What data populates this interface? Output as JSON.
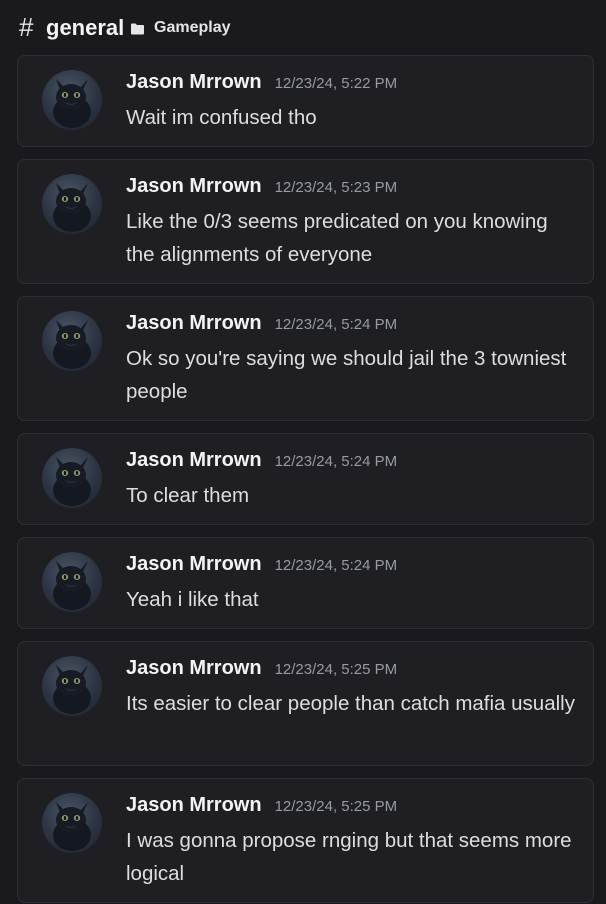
{
  "header": {
    "hash": "#",
    "channel": "general",
    "category_icon": "folder-icon",
    "category": "Gameplay"
  },
  "messages": [
    {
      "author": "Jason Mrrown",
      "time": "12/23/24, 5:22 PM",
      "text": "Wait im confused tho"
    },
    {
      "author": "Jason Mrrown",
      "time": "12/23/24, 5:23 PM",
      "text": "Like the 0/3 seems predicated on you knowing the alignments of everyone"
    },
    {
      "author": "Jason Mrrown",
      "time": "12/23/24, 5:24 PM",
      "text": "Ok so you're saying we should jail the 3 towniest people"
    },
    {
      "author": "Jason Mrrown",
      "time": "12/23/24, 5:24 PM",
      "text": "To clear them"
    },
    {
      "author": "Jason Mrrown",
      "time": "12/23/24, 5:24 PM",
      "text": "Yeah i like that"
    },
    {
      "author": "Jason Mrrown",
      "time": "12/23/24, 5:25 PM",
      "text": "Its easier to clear people than catch mafia usually"
    },
    {
      "author": "Jason Mrrown",
      "time": "12/23/24, 5:25 PM",
      "text": "I was gonna propose rnging but that seems more logical"
    }
  ],
  "colors": {
    "background": "#1a1a1e",
    "card": "#1f1f23",
    "author": "#f2f3f5",
    "timestamp": "#949ba4",
    "text": "#dbdee1"
  }
}
